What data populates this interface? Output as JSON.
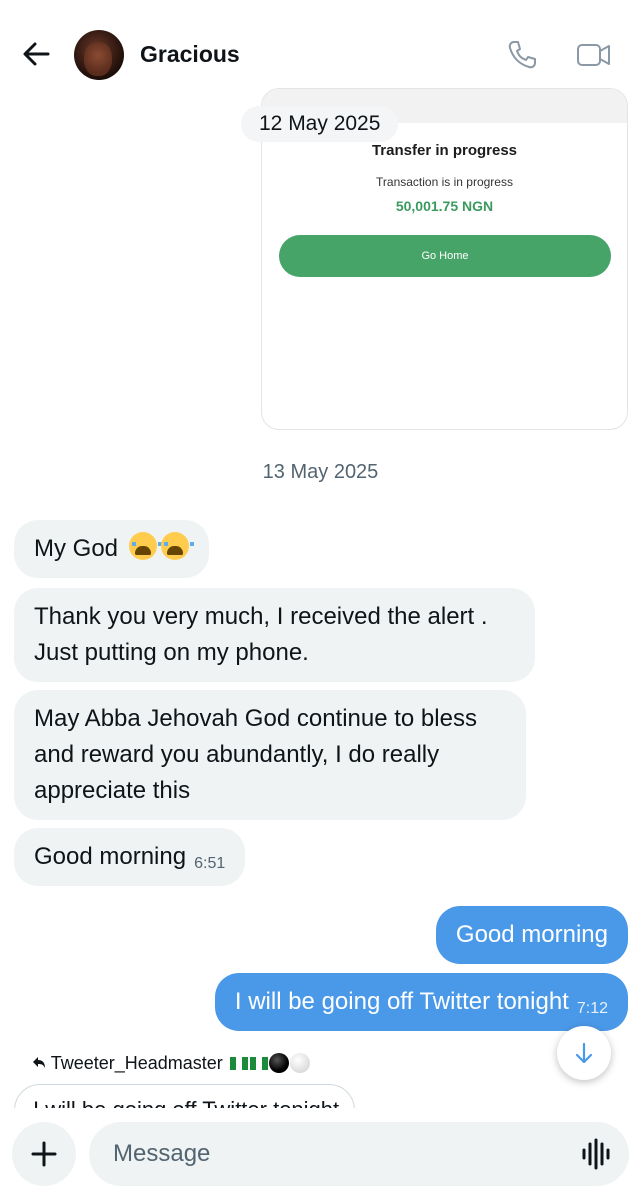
{
  "header": {
    "contact_name": "Gracious",
    "icons": [
      "back-arrow-icon",
      "phone-icon",
      "video-icon"
    ]
  },
  "shared_image": {
    "title": "Transfer in progress",
    "subtitle": "Transaction is in progress",
    "amount": "50,001.75 NGN",
    "button_label": "Go Home",
    "amount_color": "#3c9a5f",
    "button_color": "#47a468"
  },
  "dates": {
    "first": "12 May 2025",
    "second": "13 May 2025"
  },
  "messages": {
    "incoming": [
      {
        "text": "My God"
      },
      {
        "line1": "Thank you very much, I received the alert .",
        "line2": "Just putting on my phone."
      },
      {
        "line1": "May Abba Jehovah God continue to bless",
        "line2": "and reward you abundantly, I do really",
        "line3": "appreciate this"
      },
      {
        "text": "Good morning",
        "time": "6:51"
      }
    ],
    "outgoing": [
      {
        "text": "Good morning"
      },
      {
        "text": "I will be going off Twitter tonight",
        "time": "7:12"
      }
    ]
  },
  "reply": {
    "username": "Tweeter_Headmaster",
    "preview_text": "I will be going off Twitter tonight"
  },
  "composer": {
    "placeholder": "Message"
  },
  "colors": {
    "outgoing_bubble": "#4a99e9",
    "incoming_bubble": "#eff3f4",
    "date_text": "#536471"
  }
}
